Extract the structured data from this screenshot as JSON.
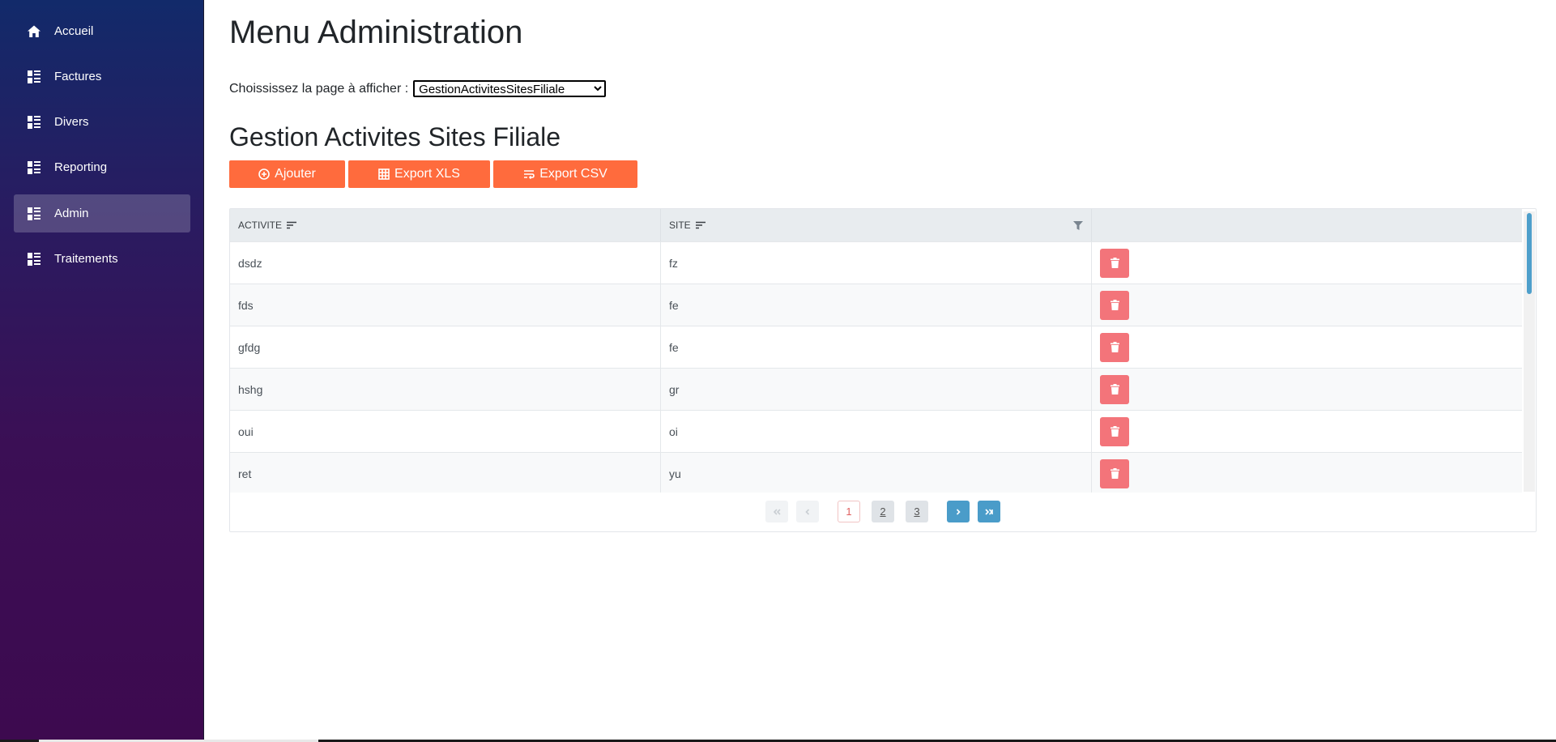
{
  "sidebar": {
    "items": [
      {
        "label": "Accueil",
        "icon": "home-icon",
        "active": false
      },
      {
        "label": "Factures",
        "icon": "list-icon",
        "active": false
      },
      {
        "label": "Divers",
        "icon": "list-icon",
        "active": false
      },
      {
        "label": "Reporting",
        "icon": "list-icon",
        "active": false
      },
      {
        "label": "Admin",
        "icon": "list-icon",
        "active": true
      },
      {
        "label": "Traitements",
        "icon": "list-icon",
        "active": false
      }
    ]
  },
  "main": {
    "title": "Menu Administration",
    "chooser_label": "Choississez la page à afficher :",
    "chooser_value": "GestionActivitesSitesFiliale",
    "section_title": "Gestion Activites Sites Filiale",
    "buttons": {
      "add": "Ajouter",
      "export_xls": "Export XLS",
      "export_csv": "Export CSV"
    },
    "accent_color": "#ff6b3d",
    "delete_color": "#f3747a"
  },
  "table": {
    "headers": [
      "ACTIVITE",
      "SITE",
      ""
    ],
    "rows": [
      [
        "dsdz",
        "fz"
      ],
      [
        "fds",
        "fe"
      ],
      [
        "gfdg",
        "fe"
      ],
      [
        "hshg",
        "gr"
      ],
      [
        "oui",
        "oi"
      ],
      [
        "ret",
        "yu"
      ]
    ]
  },
  "pagination": {
    "pages": [
      "1",
      "2",
      "3"
    ],
    "current": "1"
  }
}
